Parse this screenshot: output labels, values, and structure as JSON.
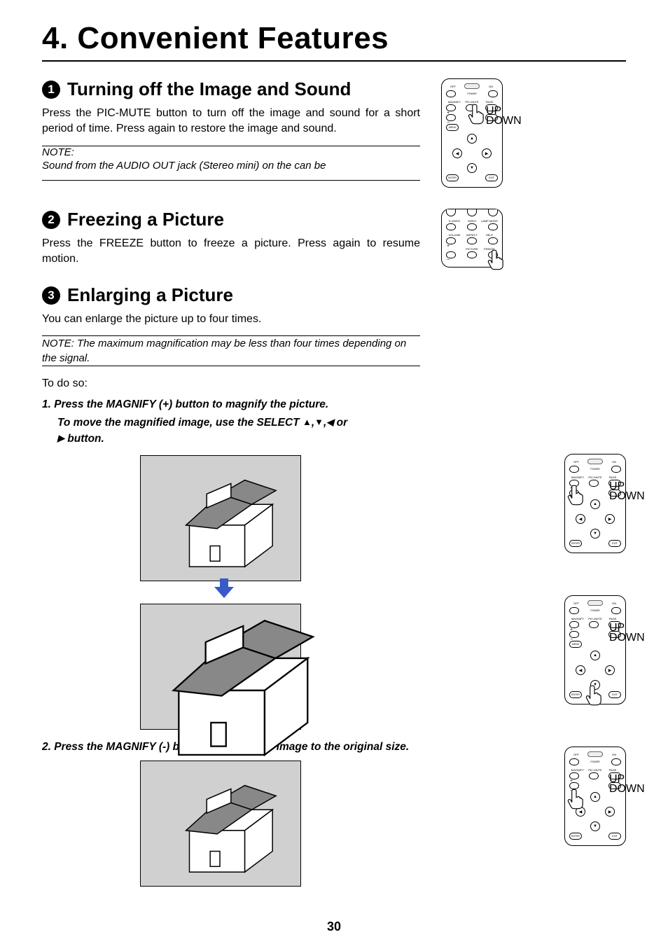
{
  "chapter_title": "4. Convenient Features",
  "page_number": "30",
  "sections": {
    "s1": {
      "num": "1",
      "title": "Turning off the Image and Sound",
      "body": "Press the PIC-MUTE button to turn off the image and sound for a short period of time. Press again to restore the image and sound.",
      "note_label": "NOTE:",
      "note_text": "Sound from the AUDIO OUT jack (Stereo mini) on the can be"
    },
    "s2": {
      "num": "2",
      "title": "Freezing a Picture",
      "body": "Press the FREEZE button to freeze a picture. Press again to resume motion."
    },
    "s3": {
      "num": "3",
      "title": "Enlarging a Picture",
      "body": "You can enlarge the picture up to four times.",
      "note_inline": "NOTE: The maximum magnification may be less than four times depending on the signal.",
      "todo": "To do so:",
      "step1_a": "1.  Press the MAGNIFY (+) button to magnify the picture.",
      "step1_b_pre": "To move the magnified image, use the SELECT ",
      "step1_b_post": " button.",
      "step1_b_or": " or ",
      "step2": "2.  Press the MAGNIFY (-) button to return the image to the original size."
    }
  },
  "remote_labels": {
    "off": "OFF",
    "on": "ON",
    "power": "POWER",
    "magnify": "MAGNIFY",
    "picmute": "PIC-MUTE",
    "page": "PAGE",
    "up": "UP",
    "down": "DOWN",
    "menu": "MENU",
    "enter": "ENTER",
    "exit": "EXIT",
    "svideo": "S-VIDEO",
    "video": "VIDEO",
    "lampmode": "LAMP MODE",
    "volume": "VOLUME",
    "aspect": "ASPECT",
    "help": "HELP",
    "picture": "PICTURE",
    "freeze": "FREEZE"
  }
}
